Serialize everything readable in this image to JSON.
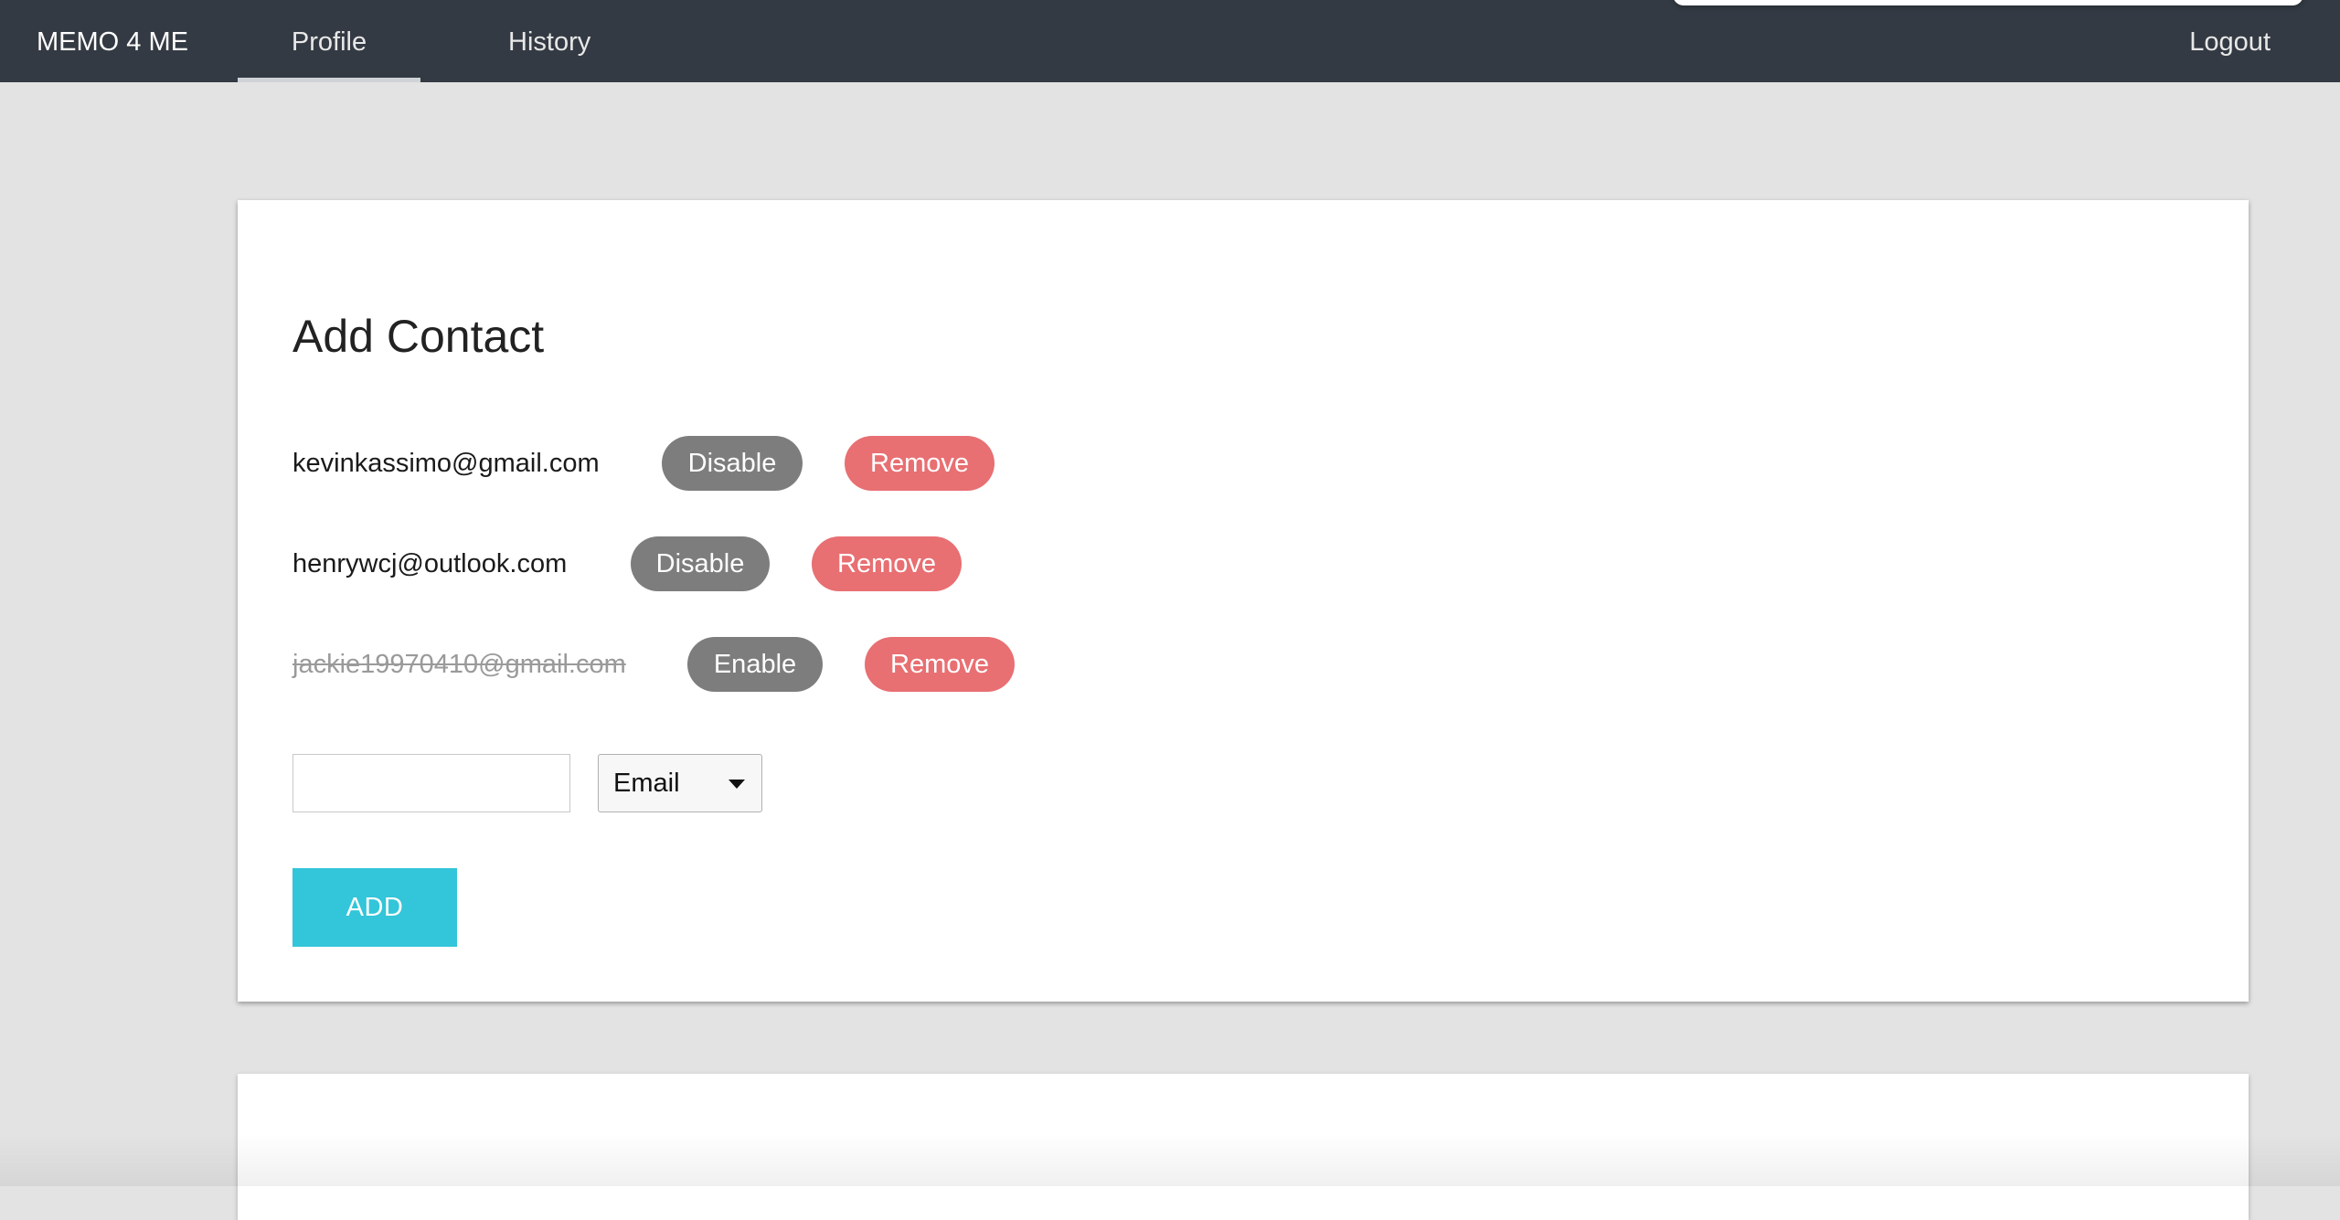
{
  "navbar": {
    "brand": "MEMO 4 ME",
    "tabs": [
      {
        "label": "Profile",
        "active": true
      },
      {
        "label": "History",
        "active": false
      }
    ],
    "logout_label": "Logout"
  },
  "add_contact": {
    "title": "Add Contact",
    "contacts": [
      {
        "email": "kevinkassimo@gmail.com",
        "enabled": true,
        "toggle_label": "Disable",
        "remove_label": "Remove"
      },
      {
        "email": "henrywcj@outlook.com",
        "enabled": true,
        "toggle_label": "Disable",
        "remove_label": "Remove"
      },
      {
        "email": "jackie19970410@gmail.com",
        "enabled": false,
        "toggle_label": "Enable",
        "remove_label": "Remove"
      }
    ],
    "new_contact_value": "",
    "contact_type_selected": "Email",
    "add_label": "ADD"
  },
  "colors": {
    "navbar_bg": "#343a43",
    "page_bg": "#e3e3e3",
    "toggle_button": "#7d7d7d",
    "remove_button": "#e86f72",
    "add_button": "#33c5d9"
  }
}
